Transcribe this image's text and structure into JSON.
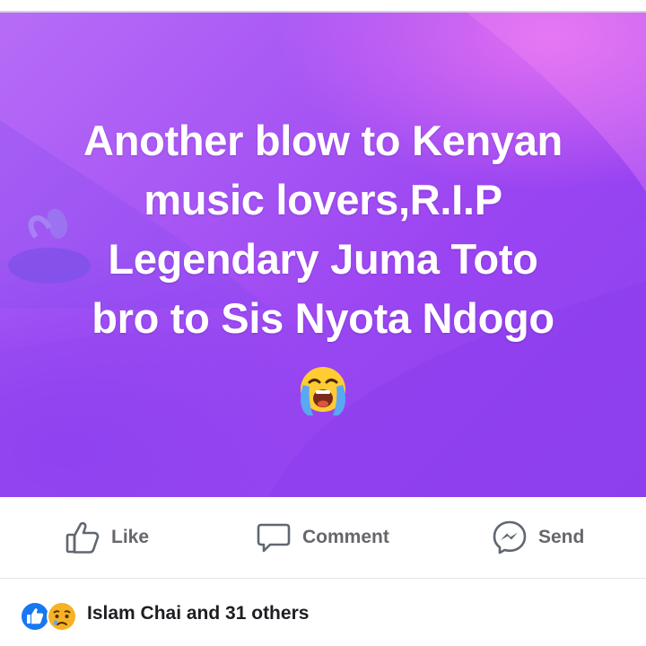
{
  "post": {
    "text": "Another blow to Kenyan\nmusic lovers,R.I.P\nLegendary Juma Toto\nbro to Sis Nyota Ndogo",
    "emoji": "loudly-crying-face",
    "background_colors": [
      "#b76cf7",
      "#9b45f2",
      "#e06ef2",
      "#8a3ef0"
    ]
  },
  "actions": {
    "like_label": "Like",
    "comment_label": "Comment",
    "send_label": "Send"
  },
  "reactions": {
    "icons": [
      "like-icon",
      "sad-icon"
    ],
    "summary": "Islam Chai and 31 others"
  },
  "colors": {
    "action_text": "#65676b",
    "like_blue": "#1877f2",
    "reaction_text": "#1c1e21"
  }
}
